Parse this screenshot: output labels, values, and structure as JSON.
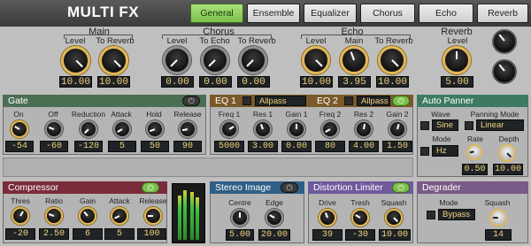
{
  "title": "MULTI FX",
  "tabs": [
    {
      "label": "General"
    },
    {
      "label": "Ensemble"
    },
    {
      "label": "Equalizer"
    },
    {
      "label": "Chorus"
    },
    {
      "label": "Echo"
    },
    {
      "label": "Reverb"
    }
  ],
  "main": {
    "title": "Main",
    "level_label": "Level",
    "level_value": "10.00",
    "reverb_label": "To Reverb",
    "reverb_value": "10.00"
  },
  "chorus": {
    "title": "Chorus",
    "level_label": "Level",
    "level_value": "0.00",
    "echo_label": "To Echo",
    "echo_value": "0.00",
    "reverb_label": "To Reverb",
    "reverb_value": "0.00"
  },
  "echo": {
    "title": "Echo",
    "level_label": "Level",
    "level_value": "10.00",
    "main_label": "Main",
    "main_value": "3.95",
    "reverb_label": "To Reverb",
    "reverb_value": "10.00"
  },
  "reverb": {
    "title": "Reverb",
    "level_label": "Level",
    "level_value": "5.00"
  },
  "gate": {
    "title": "Gate",
    "labels": [
      "On",
      "Off",
      "Reduction",
      "Attack",
      "Hold",
      "Release"
    ],
    "values": [
      "-54",
      "-60",
      "-120",
      "5",
      "50",
      "90"
    ]
  },
  "eq1": {
    "title": "EQ 1",
    "mode": "Allpass"
  },
  "eq2": {
    "title": "EQ 2",
    "mode": "Allpass"
  },
  "eq": {
    "labels": [
      "Freq 1",
      "Res 1",
      "Gain 1",
      "Freq 2",
      "Res 2",
      "Gain 2"
    ],
    "values": [
      "5000",
      "3.00",
      "0.00",
      "80",
      "4.00",
      "1.50"
    ]
  },
  "autopanner": {
    "title": "Auto Panner",
    "wave_label": "Wave",
    "wave_value": "Sine",
    "panning_label": "Panning Mode",
    "panning_value": "Linear",
    "mode_label": "Mode",
    "mode_value": "Hz",
    "rate_label": "Rate",
    "rate_value": "0.50",
    "depth_label": "Depth",
    "depth_value": "10.00"
  },
  "compressor": {
    "title": "Compressor",
    "labels": [
      "Thres",
      "Ratio",
      "Gain",
      "Attack",
      "Release"
    ],
    "values": [
      "-20",
      "2.50",
      "6",
      "5",
      "100"
    ]
  },
  "stereo": {
    "title": "Stereo Image",
    "labels": [
      "Centre",
      "Edge"
    ],
    "values": [
      "5.00",
      "20.00"
    ]
  },
  "distortion": {
    "title": "Distortion Limiter",
    "labels": [
      "Drive",
      "Tresh",
      "Squash"
    ],
    "values": [
      "39",
      "-30",
      "10.00"
    ]
  },
  "degrader": {
    "title": "Degrader",
    "mode_label": "Mode",
    "mode_value": "Bypass",
    "squash_label": "Squash",
    "squash_value": "14"
  },
  "colors": {
    "gate": "#4c6e53",
    "eq": "#7a5a2a",
    "autopanner": "#3e7a62",
    "compressor": "#7a2c3a",
    "stereo": "#2f5f86",
    "distortion": "#6f5a9c",
    "degrader": "#7a5a86",
    "accent": "#7cc04b",
    "knob_ring": "#e0b75a"
  }
}
